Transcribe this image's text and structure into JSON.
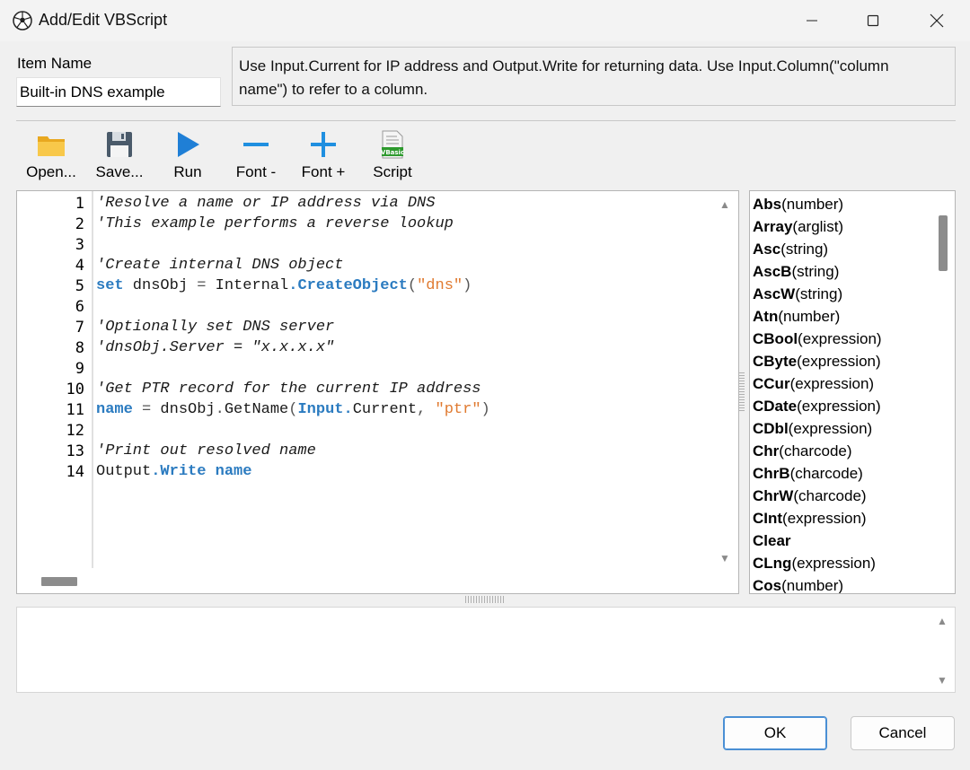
{
  "window": {
    "title": "Add/Edit VBScript",
    "minimize_icon": "minimize-icon",
    "maximize_icon": "maximize-icon",
    "close_icon": "close-icon"
  },
  "form": {
    "item_name_label": "Item Name",
    "item_name_value": "Built-in DNS example",
    "hint_line1": "Use Input.Current for IP address and Output.Write for returning data. Use Input.Column(\"column",
    "hint_line2": "name\") to refer to a column."
  },
  "toolbar": {
    "open_label": "Open...",
    "save_label": "Save...",
    "run_label": "Run",
    "font_minus_label": "Font -",
    "font_plus_label": "Font +",
    "script_label": "Script",
    "script_icon_text": "VBasic"
  },
  "editor": {
    "line_numbers": [
      "1",
      "2",
      "3",
      "4",
      "5",
      "6",
      "7",
      "8",
      "9",
      "10",
      "11",
      "12",
      "13",
      "14"
    ],
    "l1": "'Resolve a name or IP address via DNS",
    "l2": "'This example performs a reverse lookup",
    "l4": "'Create internal DNS object",
    "l5_set": "set",
    "l5_a": " dnsObj ",
    "l5_eq": "=",
    "l5_b": " Internal",
    "l5_dot": ".",
    "l5_fn": "CreateObject",
    "l5_paren_open": "(",
    "l5_str": "\"dns\"",
    "l5_paren_close": ")",
    "l7": "'Optionally set DNS server",
    "l8": "'dnsObj.Server = \"x.x.x.x\"",
    "l10": "'Get PTR record for the current IP address",
    "l11_name": "name",
    "l11_eq": " = ",
    "l11_a": "dnsObj",
    "l11_dot": ".",
    "l11_b": "GetName",
    "l11_po": "(",
    "l11_input": "Input",
    "l11_dot2": ".",
    "l11_c": "Current",
    "l11_comma": ", ",
    "l11_str": "\"ptr\"",
    "l11_pc": ")",
    "l13": "'Print out resolved name",
    "l14_out": "Output",
    "l14_dot": ".",
    "l14_write": "Write",
    "l14_name": "name"
  },
  "functions": [
    {
      "name": "Abs",
      "args": "(number)"
    },
    {
      "name": "Array",
      "args": "(arglist)"
    },
    {
      "name": "Asc",
      "args": "(string)"
    },
    {
      "name": "AscB",
      "args": "(string)"
    },
    {
      "name": "AscW",
      "args": "(string)"
    },
    {
      "name": "Atn",
      "args": "(number)"
    },
    {
      "name": "CBool",
      "args": "(expression)"
    },
    {
      "name": "CByte",
      "args": "(expression)"
    },
    {
      "name": "CCur",
      "args": "(expression)"
    },
    {
      "name": "CDate",
      "args": "(expression)"
    },
    {
      "name": "CDbl",
      "args": "(expression)"
    },
    {
      "name": "Chr",
      "args": "(charcode)"
    },
    {
      "name": "ChrB",
      "args": "(charcode)"
    },
    {
      "name": "ChrW",
      "args": "(charcode)"
    },
    {
      "name": "CInt",
      "args": "(expression)"
    },
    {
      "name": "Clear",
      "args": ""
    },
    {
      "name": "CLng",
      "args": "(expression)"
    },
    {
      "name": "Cos",
      "args": "(number)"
    }
  ],
  "buttons": {
    "ok_label": "OK",
    "cancel_label": "Cancel"
  },
  "colors": {
    "keyword": "#2b7bc0",
    "string": "#e07a30",
    "run_icon": "#1f7fd6",
    "font_icons": "#1f8fe0"
  }
}
